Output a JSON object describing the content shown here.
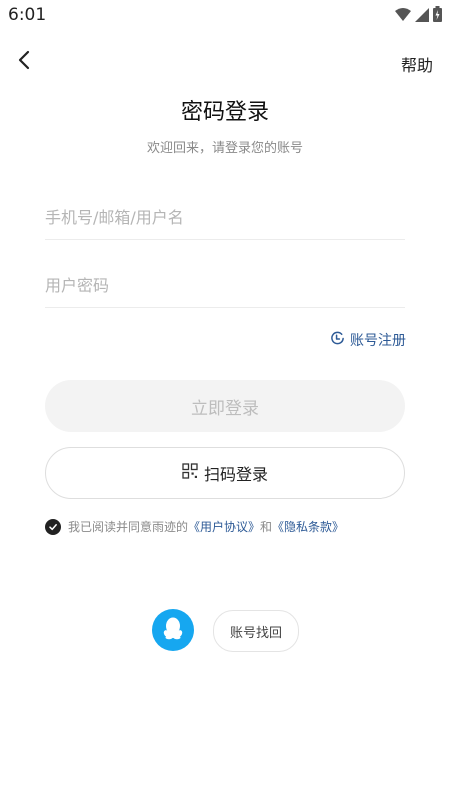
{
  "status_bar": {
    "time": "6:01",
    "icons": [
      "wifi-icon",
      "signal-icon",
      "battery-icon"
    ]
  },
  "header": {
    "back_icon": "back-arrow-icon",
    "help_label": "帮助"
  },
  "title": "密码登录",
  "subtitle": "欢迎回来，请登录您的账号",
  "form": {
    "account_placeholder": "手机号/邮箱/用户名",
    "account_value": "",
    "password_placeholder": "用户密码",
    "password_value": ""
  },
  "register_label": "账号注册",
  "login_button": "立即登录",
  "scan_login_button": "扫码登录",
  "agreement": {
    "checked": true,
    "prefix": "我已阅读并同意雨迹的",
    "user_agreement": "《用户协议》",
    "and": "和",
    "privacy_policy": "《隐私条款》"
  },
  "recover_account": "账号找回",
  "colors": {
    "accent": "#2d5a96",
    "qq_blue": "#16a7f0",
    "login_button_bg": "#f3f3f3",
    "login_button_text": "#bdbdbd"
  }
}
